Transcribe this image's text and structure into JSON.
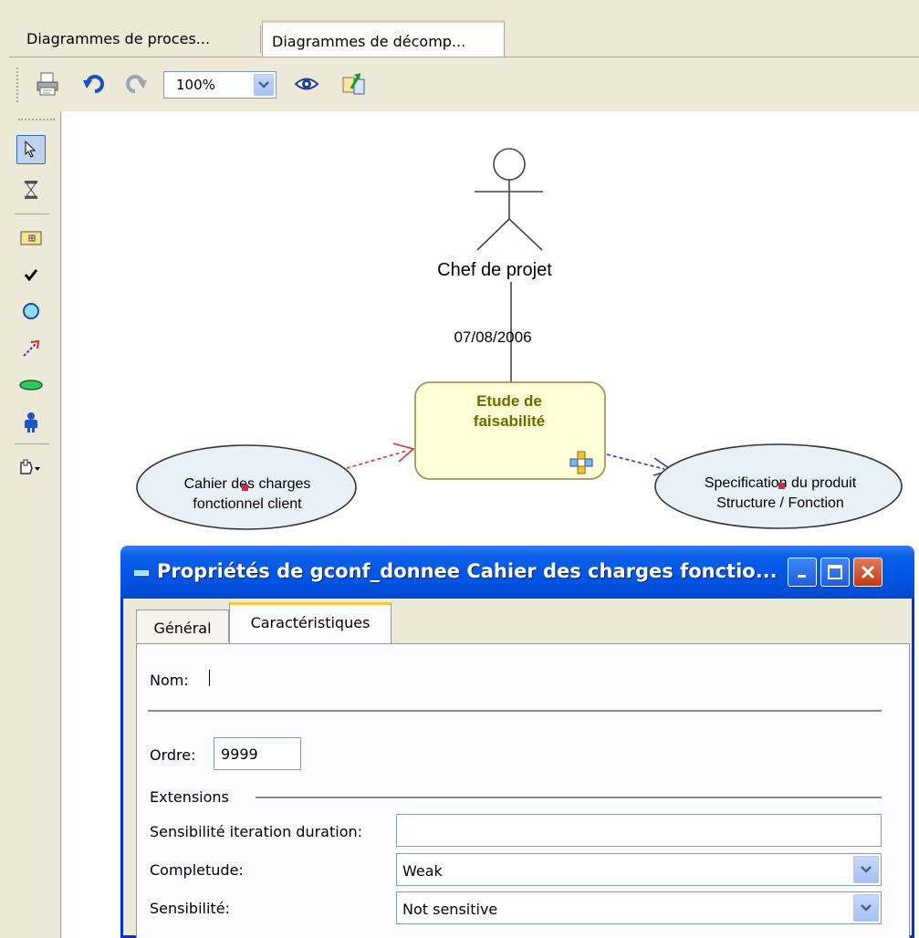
{
  "tabs": [
    {
      "label": "Diagrammes de proces..."
    },
    {
      "label": "Diagrammes de décomp..."
    }
  ],
  "toolbar": {
    "zoom_value": "100%",
    "icons": [
      "printer-icon",
      "undo-icon",
      "redo-icon",
      "eye-icon",
      "export-icon"
    ]
  },
  "palette": {
    "icons": [
      "pointer-icon",
      "hourglass-icon",
      "folder-icon",
      "check-icon",
      "circle-icon",
      "arrow-icon",
      "ellipse-icon",
      "actor-icon",
      "shape-menu-icon"
    ]
  },
  "diagram": {
    "actor_label": "Chef de projet",
    "date_label": "07/08/2006",
    "activity_label": [
      "Etude de",
      "faisabilité"
    ],
    "input_label": [
      "Cahier des charges",
      "fonctionnel client"
    ],
    "output_label": [
      "Specification du produit",
      "Structure / Fonction"
    ],
    "colors": {
      "activity_fill": "#ffffd8",
      "activity_border": "#9a9a5a",
      "activity_text": "#6b6b00",
      "ellipse_fill": "#e8f1f8",
      "input_arrow": "#e33030",
      "output_arrow": "#3030d8"
    }
  },
  "dialog": {
    "title": "Propriétés de gconf_donnee Cahier des charges fonctio...",
    "tabs": [
      {
        "label": "Général"
      },
      {
        "label": "Caractéristiques"
      }
    ],
    "nom_label": "Nom:",
    "nom_value": "",
    "ordre_label": "Ordre:",
    "ordre_value": "9999",
    "extensions_label": "Extensions",
    "sensibilite_duration_label": "Sensibilité iteration duration:",
    "sensibilite_duration_value": "",
    "completude_label": "Completude:",
    "completude_value": "Weak",
    "sensibilite_label": "Sensibilité:",
    "sensibilite_value": "Not sensitive"
  }
}
